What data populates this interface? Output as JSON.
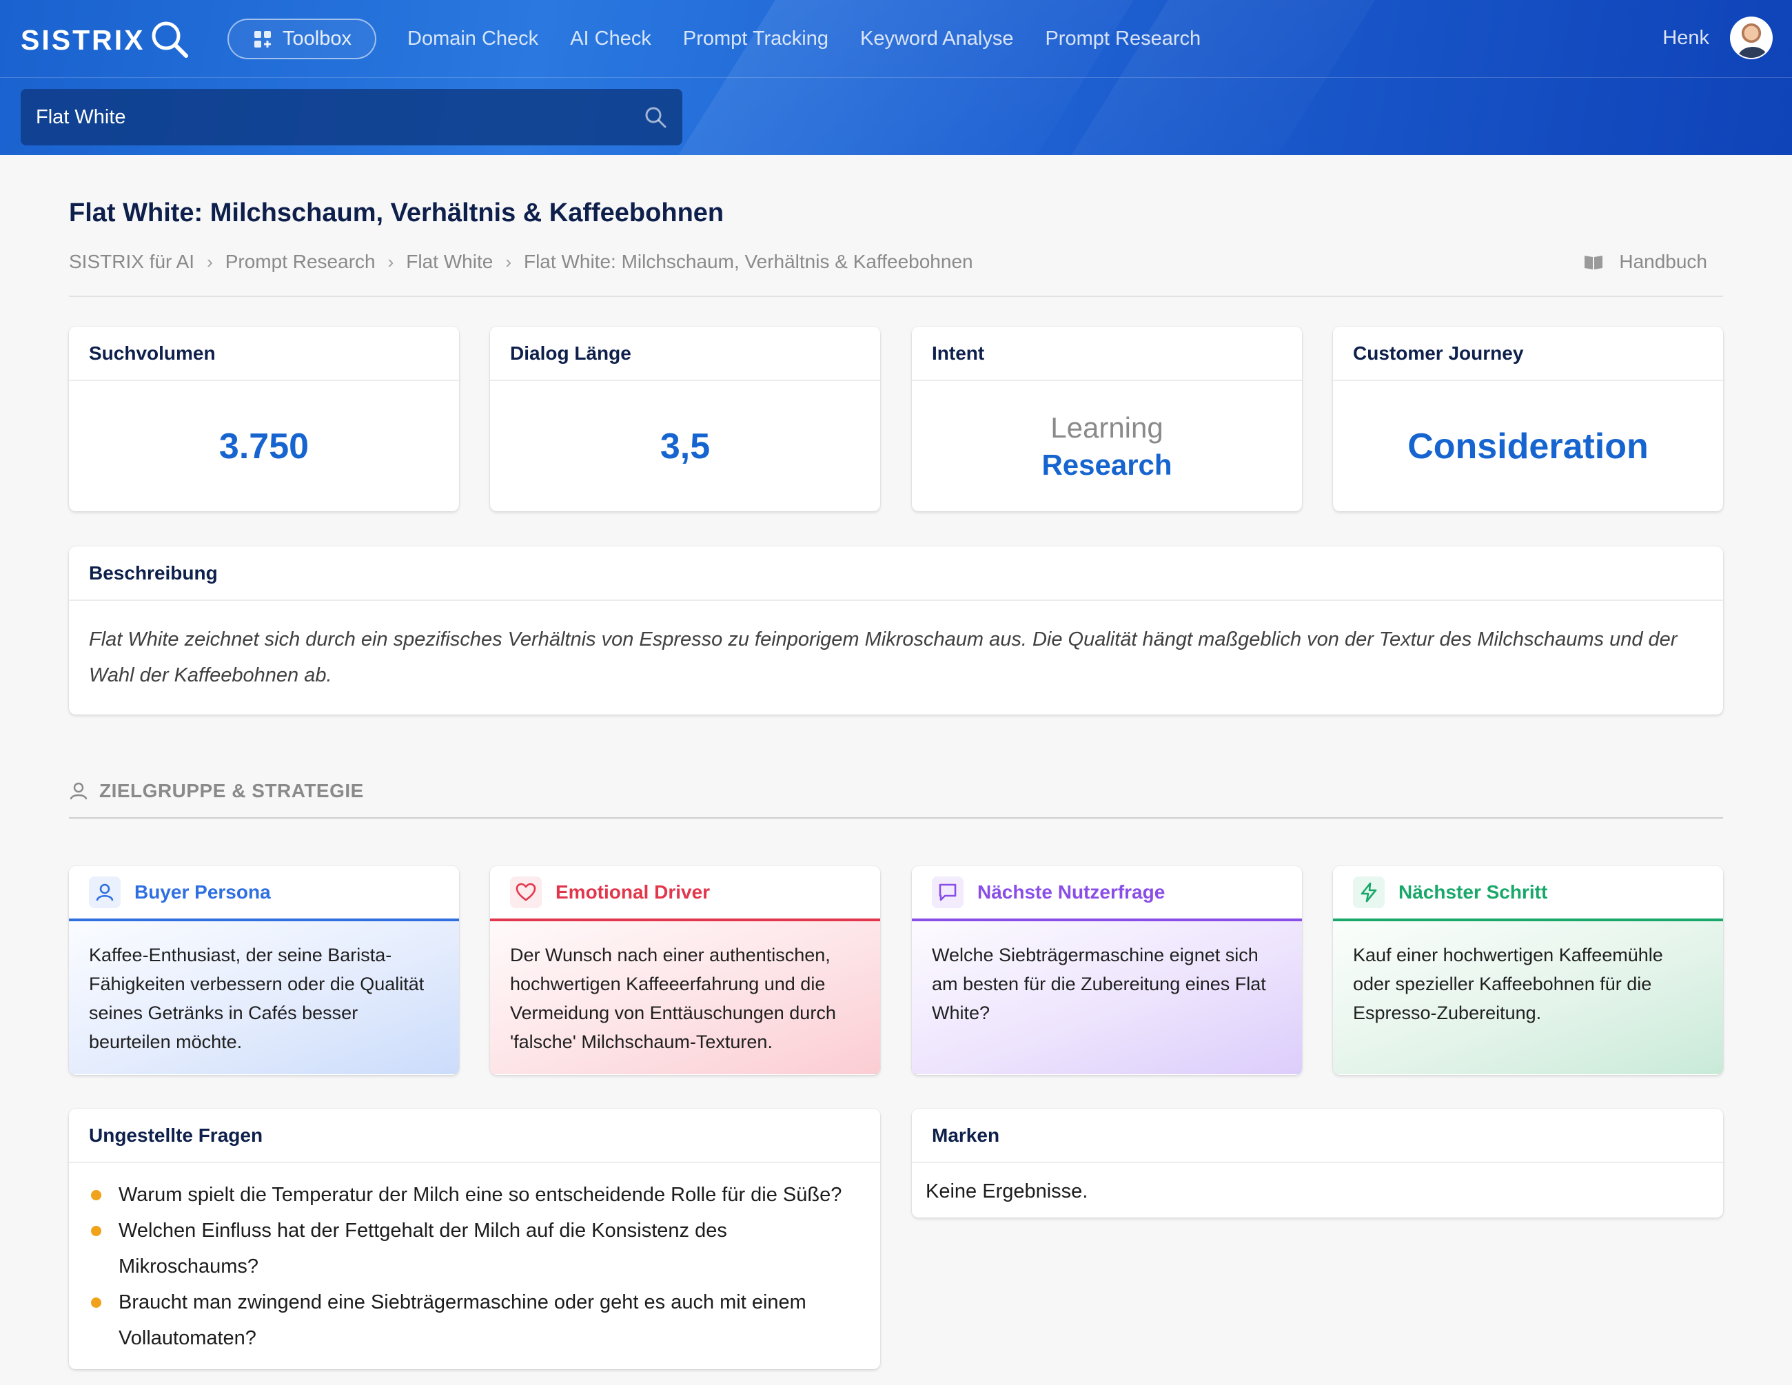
{
  "header": {
    "logo": "SISTRIX",
    "toolbox_label": "Toolbox",
    "nav": [
      "Domain Check",
      "AI Check",
      "Prompt Tracking",
      "Keyword Analyse",
      "Prompt Research"
    ],
    "user_name": "Henk",
    "search": {
      "value": "Flat White",
      "icon": "search-icon"
    }
  },
  "page": {
    "title": "Flat White: Milchschaum, Verhältnis & Kaffeebohnen",
    "breadcrumb": [
      "SISTRIX für AI",
      "Prompt Research",
      "Flat White",
      "Flat White: Milchschaum, Verhältnis & Kaffeebohnen"
    ],
    "breadcrumb_separator": "›",
    "handbook_label": "Handbuch"
  },
  "metrics": {
    "search_volume": {
      "label": "Suchvolumen",
      "value": "3.750"
    },
    "dialog_length": {
      "label": "Dialog Länge",
      "value": "3,5"
    },
    "intent": {
      "label": "Intent",
      "primary": "Learning",
      "secondary": "Research"
    },
    "customer_journey": {
      "label": "Customer Journey",
      "value": "Consideration"
    }
  },
  "description": {
    "label": "Beschreibung",
    "text": "Flat White zeichnet sich durch ein spezifisches Verhältnis von Espresso zu feinporigem Mikroschaum aus. Die Qualität hängt maßgeblich von der Textur des Milchschaums und der Wahl der Kaffeebohnen ab."
  },
  "strategy": {
    "section_label": "ZIELGRUPPE & STRATEGIE",
    "cards": [
      {
        "title": "Buyer Persona",
        "icon": "user-icon",
        "color": "#2f6fe0",
        "text": "Kaffee-Enthusiast, der seine Barista-Fähigkeiten verbessern oder die Qualität seines Getränks in Cafés besser beurteilen möchte."
      },
      {
        "title": "Emotional Driver",
        "icon": "heart-icon",
        "color": "#e2364c",
        "text": "Der Wunsch nach einer authentischen, hochwertigen Kaffeeerfahrung und die Vermeidung von Enttäuschungen durch 'falsche' Milchschaum-Texturen."
      },
      {
        "title": "Nächste Nutzerfrage",
        "icon": "chat-bubble-icon",
        "color": "#8a4ee8",
        "text": "Welche Siebträgermaschine eignet sich am besten für die Zubereitung eines Flat White?"
      },
      {
        "title": "Nächster Schritt",
        "icon": "lightning-icon",
        "color": "#19a86a",
        "text": "Kauf einer hochwertigen Kaffeemühle oder spezieller Kaffeebohnen für die Espresso-Zubereitung."
      }
    ]
  },
  "unasked_questions": {
    "label": "Ungestellte Fragen",
    "items": [
      "Warum spielt die Temperatur der Milch eine so entscheidende Rolle für die Süße?",
      "Welchen Einfluss hat der Fettgehalt der Milch auf die Konsistenz des Mikroschaums?",
      "Braucht man zwingend eine Siebträgermaschine oder geht es auch mit einem Vollautomaten?"
    ]
  },
  "brands": {
    "label": "Marken",
    "empty_text": "Keine Ergebnisse."
  }
}
